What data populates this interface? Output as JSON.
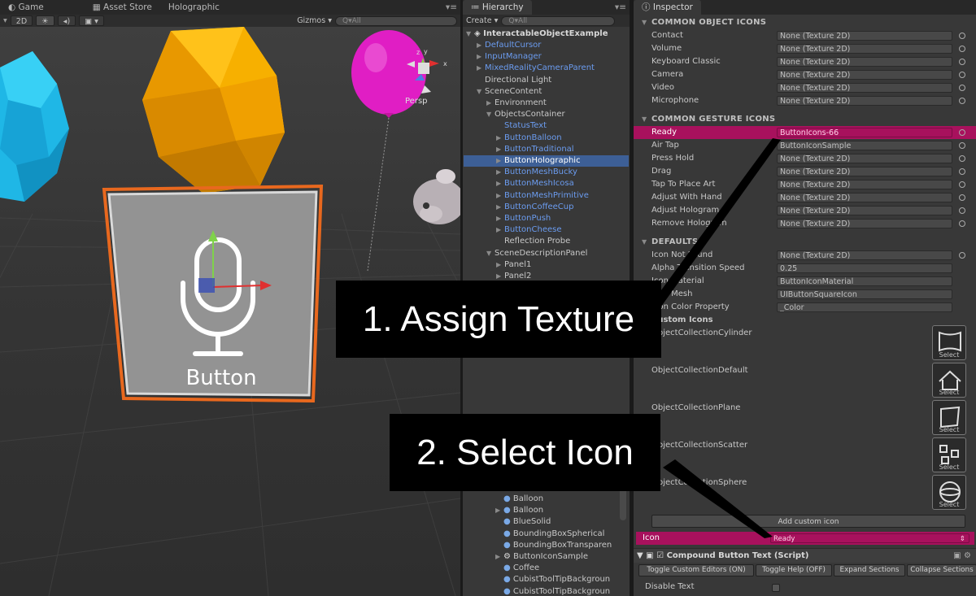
{
  "scene": {
    "tabs": [
      "Game",
      "Asset Store",
      "Holographic"
    ],
    "toolbar": {
      "mode": "2D",
      "gizmos": "Gizmos",
      "search": "All"
    },
    "persp_label": "Persp",
    "button_text": "Button"
  },
  "hierarchy": {
    "title": "Hierarchy",
    "create": "Create",
    "search": "All",
    "root": "InteractableObjectExample",
    "items": [
      {
        "label": "DefaultCursor",
        "blue": true,
        "indent": 1,
        "arrow": true
      },
      {
        "label": "InputManager",
        "blue": true,
        "indent": 1,
        "arrow": true
      },
      {
        "label": "MixedRealityCameraParent",
        "blue": true,
        "indent": 1,
        "arrow": true
      },
      {
        "label": "Directional Light",
        "blue": false,
        "indent": 1,
        "arrow": false
      },
      {
        "label": "SceneContent",
        "blue": false,
        "indent": 1,
        "arrow": true,
        "open": true
      },
      {
        "label": "Environment",
        "blue": false,
        "indent": 2,
        "arrow": true
      },
      {
        "label": "ObjectsContainer",
        "blue": false,
        "indent": 2,
        "arrow": true,
        "open": true
      },
      {
        "label": "StatusText",
        "blue": true,
        "indent": 3,
        "arrow": false
      },
      {
        "label": "ButtonBalloon",
        "blue": true,
        "indent": 3,
        "arrow": true
      },
      {
        "label": "ButtonTraditional",
        "blue": true,
        "indent": 3,
        "arrow": true
      },
      {
        "label": "ButtonHolographic",
        "blue": false,
        "indent": 3,
        "arrow": true,
        "selected": true
      },
      {
        "label": "ButtonMeshBucky",
        "blue": true,
        "indent": 3,
        "arrow": true
      },
      {
        "label": "ButtonMeshIcosa",
        "blue": true,
        "indent": 3,
        "arrow": true
      },
      {
        "label": "ButtonMeshPrimitive",
        "blue": true,
        "indent": 3,
        "arrow": true
      },
      {
        "label": "ButtonCoffeeCup",
        "blue": true,
        "indent": 3,
        "arrow": true
      },
      {
        "label": "ButtonPush",
        "blue": true,
        "indent": 3,
        "arrow": true
      },
      {
        "label": "ButtonCheese",
        "blue": true,
        "indent": 3,
        "arrow": true
      },
      {
        "label": "Reflection Probe",
        "blue": false,
        "indent": 3,
        "arrow": false
      },
      {
        "label": "SceneDescriptionPanel",
        "blue": false,
        "indent": 2,
        "arrow": true,
        "open": true
      },
      {
        "label": "Panel1",
        "blue": false,
        "indent": 3,
        "arrow": true
      },
      {
        "label": "Panel2",
        "blue": false,
        "indent": 3,
        "arrow": true
      }
    ],
    "assets": [
      "Balloon",
      "Balloon",
      "BlueSolid",
      "BoundingBoxSpherical",
      "BoundingBoxTransparen",
      "ButtonIconSample",
      "Coffee",
      "CubistToolTipBackgroun",
      "CubistToolTipBackgroun"
    ]
  },
  "inspector": {
    "title": "Inspector",
    "common_object_title": "COMMON OBJECT ICONS",
    "common_object": [
      {
        "label": "Contact",
        "value": "None (Texture 2D)"
      },
      {
        "label": "Volume",
        "value": "None (Texture 2D)"
      },
      {
        "label": "Keyboard Classic",
        "value": "None (Texture 2D)"
      },
      {
        "label": "Camera",
        "value": "None (Texture 2D)"
      },
      {
        "label": "Video",
        "value": "None (Texture 2D)"
      },
      {
        "label": "Microphone",
        "value": "None (Texture 2D)"
      }
    ],
    "gesture_title": "COMMON GESTURE ICONS",
    "gesture": [
      {
        "label": "Ready",
        "value": "ButtonIcons-66",
        "highlight": true
      },
      {
        "label": "Air Tap",
        "value": "ButtonIconSample"
      },
      {
        "label": "Press Hold",
        "value": "None (Texture 2D)"
      },
      {
        "label": "Drag",
        "value": "None (Texture 2D)"
      },
      {
        "label": "Tap To Place Art",
        "value": "None (Texture 2D)"
      },
      {
        "label": "Adjust With Hand",
        "value": "None (Texture 2D)"
      },
      {
        "label": "Adjust Hologram",
        "value": "None (Texture 2D)"
      },
      {
        "label": "Remove Hologram",
        "value": "None (Texture 2D)"
      }
    ],
    "defaults_title": "DEFAULTS",
    "defaults": [
      {
        "label": "Icon Not Found",
        "value": "None (Texture 2D)"
      },
      {
        "label": "Alpha Transition Speed",
        "value": "0.25"
      },
      {
        "label": "Icon Material",
        "value": "ButtonIconMaterial"
      },
      {
        "label": "Icon Mesh",
        "value": "UIButtonSquareIcon"
      },
      {
        "label": "Icon Color Property",
        "value": "_Color"
      }
    ],
    "custom_title": "Custom Icons",
    "custom": [
      "ObjectCollectionCylinder",
      "ObjectCollectionDefault",
      "ObjectCollectionPlane",
      "ObjectCollectionScatter",
      "ObjectCollectionSphere"
    ],
    "select_label": "Select",
    "add_custom": "Add custom icon",
    "icon_label": "Icon",
    "icon_value": "Ready",
    "component_title": "Compound Button Text (Script)",
    "buttons": [
      "Toggle Custom Editors (ON)",
      "Toggle Help (OFF)",
      "Expand Sections",
      "Collapse Sections"
    ],
    "disable_text": "Disable Text"
  },
  "callouts": {
    "assign": "1. Assign Texture",
    "select": "2. Select Icon"
  },
  "colors": {
    "accent_pink": "#a8115d",
    "selection_blue": "#3d5f96",
    "prefab_blue": "#6b9cf0",
    "orange_outline": "#e8681e"
  }
}
